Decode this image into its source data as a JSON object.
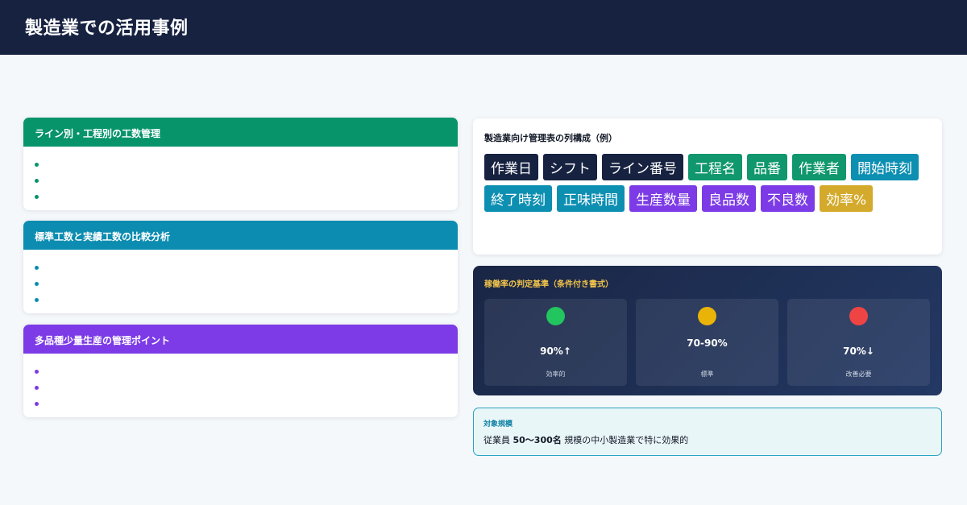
{
  "header": {
    "title": "製造業での活用事例"
  },
  "cards": [
    {
      "title": "ライン別・工程別の工数管理",
      "color": "#07946b",
      "bullets": [
        "",
        "",
        ""
      ]
    },
    {
      "title": "標準工数と実績工数の比較分析",
      "color": "#0c8cb0",
      "bullets": [
        "",
        "",
        ""
      ]
    },
    {
      "title": "多品種少量生産の管理ポイント",
      "color": "#7c3be6",
      "bullets": [
        "",
        "",
        ""
      ]
    }
  ],
  "columns_panel": {
    "title": "製造業向け管理表の列構成（例）",
    "tags": [
      {
        "label": "作業日",
        "color": "#172241"
      },
      {
        "label": "シフト",
        "color": "#172241"
      },
      {
        "label": "ライン番号",
        "color": "#172241"
      },
      {
        "label": "工程名",
        "color": "#10976d"
      },
      {
        "label": "品番",
        "color": "#10976d"
      },
      {
        "label": "作業者",
        "color": "#10976d"
      },
      {
        "label": "開始時刻",
        "color": "#0d8fb2"
      },
      {
        "label": "終了時刻",
        "color": "#0d8fb2"
      },
      {
        "label": "正味時間",
        "color": "#0d8fb2"
      },
      {
        "label": "生産数量",
        "color": "#7c3be6"
      },
      {
        "label": "良品数",
        "color": "#7c3be6"
      },
      {
        "label": "不良数",
        "color": "#7c3be6"
      },
      {
        "label": "効率%",
        "color": "#d4aa2c"
      }
    ]
  },
  "criteria": {
    "title": "稼働率の判定基準（条件付き書式）",
    "items": [
      {
        "value": "90%↑",
        "label": "効率的",
        "color": "#22c55e"
      },
      {
        "value": "70-90%",
        "label": "標準",
        "color": "#eab308"
      },
      {
        "value": "70%↓",
        "label": "改善必要",
        "color": "#ef4444"
      }
    ]
  },
  "scale": {
    "title": "対象規模",
    "prefix": "従業員 ",
    "highlight": "50〜300名",
    "suffix": " 規模の中小製造業で特に効果的"
  }
}
